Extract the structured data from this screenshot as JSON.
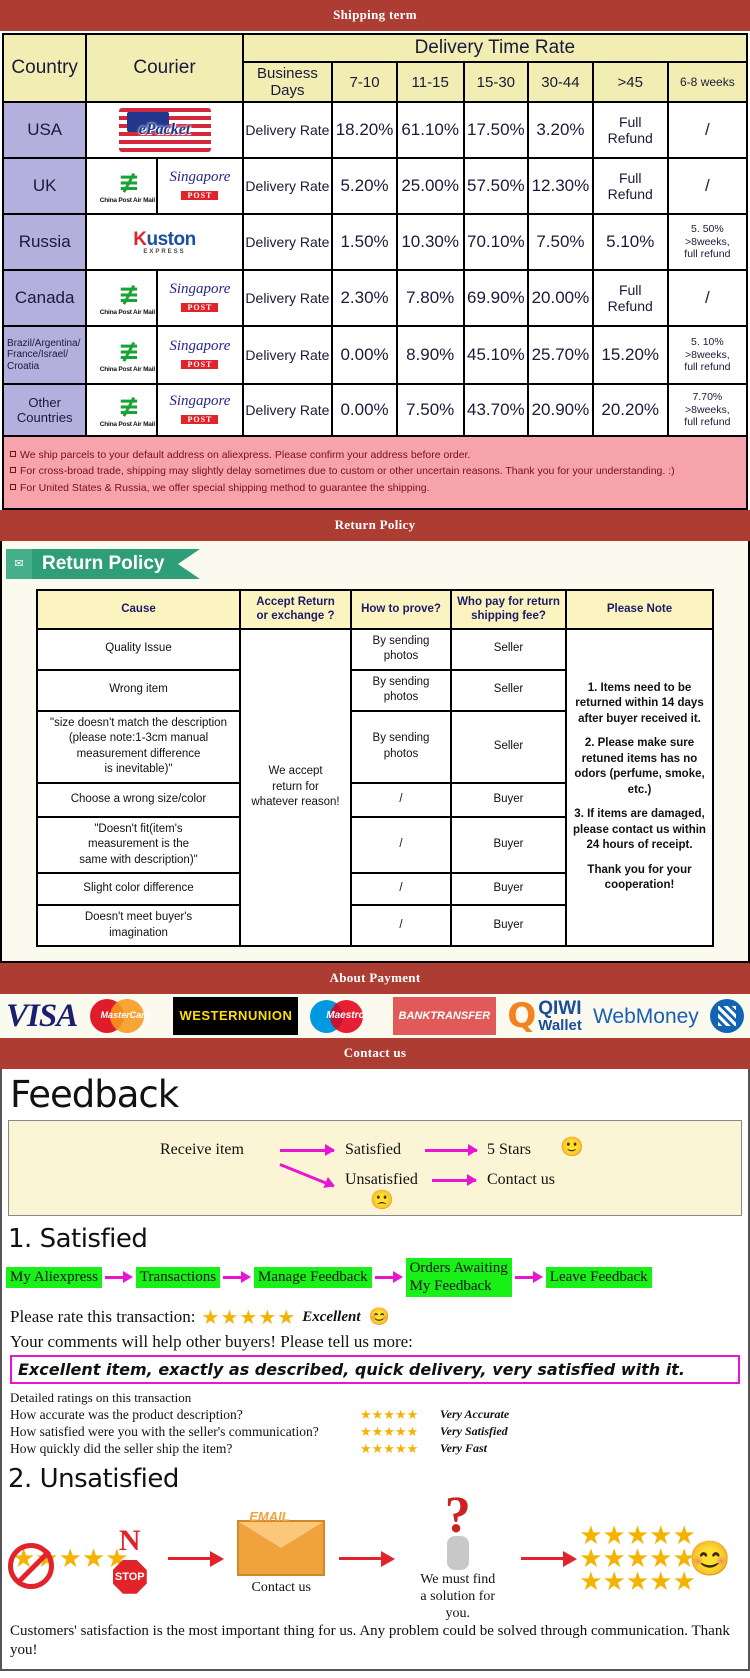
{
  "banners": {
    "shipping": "Shipping term",
    "return": "Return Policy",
    "payment": "About Payment",
    "contact": "Contact us"
  },
  "shipping": {
    "headers": {
      "country": "Country",
      "courier": "Courier",
      "delivery_time_rate": "Delivery Time Rate",
      "business_days": "Business Days",
      "cols": [
        "7-10",
        "11-15",
        "15-30",
        "30-44",
        ">45",
        "6-8 weeks"
      ]
    },
    "rate_label": "Delivery Rate",
    "rows": [
      {
        "country": "USA",
        "couriers": [
          "epacket"
        ],
        "values": [
          "18.20%",
          "61.10%",
          "17.50%",
          "3.20%",
          "Full Refund",
          "/"
        ]
      },
      {
        "country": "UK",
        "couriers": [
          "china-post-air-mail",
          "singapore-post"
        ],
        "values": [
          "5.20%",
          "25.00%",
          "57.50%",
          "12.30%",
          "Full Refund",
          "/"
        ]
      },
      {
        "country": "Russia",
        "couriers": [
          "kuston-express"
        ],
        "values": [
          "1.50%",
          "10.30%",
          "70.10%",
          "7.50%",
          "5.10%",
          "5. 50%\n>8weeks,\nfull refund"
        ]
      },
      {
        "country": "Canada",
        "couriers": [
          "china-post-air-mail",
          "singapore-post"
        ],
        "values": [
          "2.30%",
          "7.80%",
          "69.90%",
          "20.00%",
          "Full Refund",
          "/"
        ]
      },
      {
        "country": "Brazil/Argentina/\nFrance/Israel/\nCroatia",
        "couriers": [
          "china-post-air-mail",
          "singapore-post"
        ],
        "values": [
          "0.00%",
          "8.90%",
          "45.10%",
          "25.70%",
          "15.20%",
          "5. 10%\n>8weeks,\nfull refund"
        ]
      },
      {
        "country": "Other Countries",
        "couriers": [
          "china-post-air-mail",
          "singapore-post"
        ],
        "values": [
          "0.00%",
          "7.50%",
          "43.70%",
          "20.90%",
          "20.20%",
          "7.70%\n>8weeks,\nfull refund"
        ]
      }
    ],
    "logo_text": {
      "epacket": "ePacket",
      "china_post": "China Post Air Mail",
      "singapore": "Singapore",
      "singapore_post": "POST",
      "kuston_k": "K",
      "kuston_rest": "uston",
      "kuston_sub": "EXPRESS"
    },
    "notes": [
      "We ship parcels to your default address on aliexpress. Please confirm your address before order.",
      "For cross-broad trade, shipping may slightly delay sometimes due to custom or other uncertain reasons. Thank you for your understanding. :)",
      "For United States & Russia, we offer special shipping method to guarantee the shipping."
    ]
  },
  "return_policy": {
    "ribbon_label": "Return Policy",
    "ribbon_icon": "mail-icon",
    "headers": [
      "Cause",
      "Accept Return\nor exchange ?",
      "How to prove?",
      "Who pay for return\nshipping fee?",
      "Please Note"
    ],
    "accept_text": "We accept\nreturn for\nwhatever reason!",
    "rows": [
      {
        "cause": "Quality Issue",
        "prove": "By sending\nphotos",
        "payer": "Seller"
      },
      {
        "cause": "Wrong item",
        "prove": "By sending\nphotos",
        "payer": "Seller"
      },
      {
        "cause": "\"size doesn't match the description\n(please note:1-3cm manual\nmeasurement difference\nis inevitable)\"",
        "prove": "By sending\nphotos",
        "payer": "Seller"
      },
      {
        "cause": "Choose a wrong size/color",
        "prove": "/",
        "payer": "Buyer"
      },
      {
        "cause": "\"Doesn't fit(item's\nmeasurement is the\nsame with description)\"",
        "prove": "/",
        "payer": "Buyer"
      },
      {
        "cause": "Slight color difference",
        "prove": "/",
        "payer": "Buyer"
      },
      {
        "cause": "Doesn't meet buyer's\nimagination",
        "prove": "/",
        "payer": "Buyer"
      }
    ],
    "notes": [
      "1. Items need to be returned within 14 days after buyer received it.",
      "2. Please make sure retuned items has no odors (perfume, smoke, etc.)",
      "3. If items are damaged, please contact us within 24 hours of receipt.",
      "Thank you for your cooperation!"
    ]
  },
  "payment": {
    "methods": [
      {
        "id": "visa-logo",
        "label": "VISA"
      },
      {
        "id": "mastercard-logo",
        "label": "MasterCard"
      },
      {
        "id": "western-union-logo",
        "label": "WESTERN UNION",
        "line1": "WESTERN",
        "line2": "UNION"
      },
      {
        "id": "maestro-logo",
        "label": "Maestro"
      },
      {
        "id": "bank-transfer-logo",
        "label": "BANK TRANSFER",
        "line1": "BANK",
        "line2": "TRANSFER"
      },
      {
        "id": "qiwi-wallet-logo",
        "label": "QIWI Wallet",
        "line1": "QIWI",
        "line2": "Wallet"
      },
      {
        "id": "webmoney-logo",
        "label": "WebMoney"
      },
      {
        "id": "webmoney-globe-icon",
        "label": ""
      }
    ]
  },
  "feedback": {
    "title": "Feedback",
    "flow": {
      "receive": "Receive item",
      "satisfied": "Satisfied",
      "five_stars": "5 Stars",
      "unsatisfied": "Unsatisfied",
      "contact_us": "Contact us",
      "happy_emoji": "🙂",
      "sad_emoji": "🙁"
    },
    "satisfied": {
      "heading": "1. Satisfied",
      "steps": [
        "My Aliexpress",
        "Transactions",
        "Manage Feedback",
        "Orders Awaiting\nMy Feedback",
        "Leave Feedback"
      ],
      "rate_label": "Please rate this transaction:",
      "stars": "★★★★★",
      "rate_value": "Excellent",
      "comment_prompt": "Your comments will help other buyers! Please tell us more:",
      "comment_text": "Excellent item, exactly as described, quick delivery, very satisfied with it.",
      "detail_heading": "Detailed ratings on this transaction",
      "details": [
        {
          "question": "How accurate was the product description?",
          "stars": "★★★★★",
          "value": "Very Accurate"
        },
        {
          "question": "How satisfied were you with the seller's communication?",
          "stars": "★★★★★",
          "value": "Very Satisfied"
        },
        {
          "question": "How quickly did the seller ship the item?",
          "stars": "★★★★★",
          "value": "Very Fast"
        }
      ]
    },
    "unsatisfied": {
      "heading": "2. Unsatisfied",
      "no_label": "N",
      "stop_label": "STOP",
      "email_label": "EMAIL",
      "contact_caption": "Contact us",
      "solution_caption": "We must find\na solution for\nyou.",
      "question_mark": "?",
      "stars_block": "★★★★★",
      "smiley": "😊"
    },
    "footer": "Customers' satisfaction is the most important thing for us. Any problem could be solved through communication. Thank you!"
  }
}
